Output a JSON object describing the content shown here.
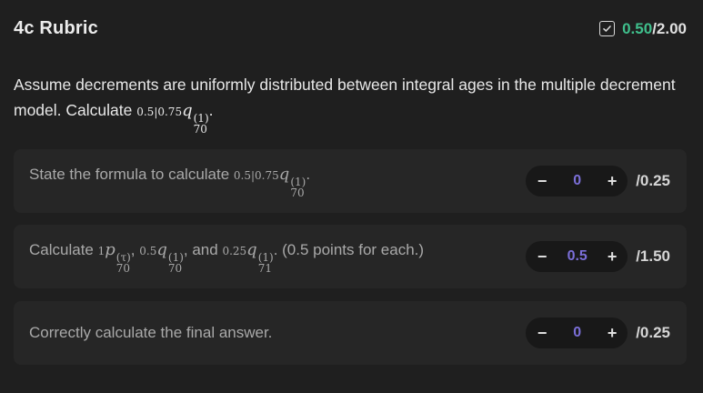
{
  "rubric": {
    "title": "4c Rubric",
    "score_earned": "0.50",
    "score_total": "/2.00",
    "icon": "checkbox-check-icon",
    "accent_color": "#3fbf8c"
  },
  "prompt": {
    "text_1": "Assume decrements are uniformly distributed between integral ages in the multiple decrement model. Calculate",
    "math": {
      "pre": "0.5|0.75",
      "var": "q",
      "sup": "(1)",
      "sub": "70"
    },
    "text_2": "."
  },
  "criteria": [
    {
      "text_1": "State the formula to calculate",
      "math": {
        "pre": "0.5|0.75",
        "var": "q",
        "sup": "(1)",
        "sub": "70"
      },
      "text_2": ".",
      "value": "0",
      "max": "/0.25"
    },
    {
      "text_1": "Calculate",
      "math_a": {
        "pre": "1",
        "var": "p",
        "sup": "(τ)",
        "sub": "70"
      },
      "sep_1": ",",
      "math_b": {
        "pre": "0.5",
        "var": "q",
        "sup": "(1)",
        "sub": "70"
      },
      "sep_2": ", and",
      "math_c": {
        "pre": "0.25",
        "var": "q",
        "sup": "(1)",
        "sub": "71"
      },
      "text_2": ". (0.5 points for each.)",
      "value": "0.5",
      "max": "/1.50"
    },
    {
      "text_1": "Correctly calculate the final answer.",
      "value": "0",
      "max": "/0.25"
    }
  ],
  "stepper": {
    "minus": "−",
    "plus": "+"
  }
}
